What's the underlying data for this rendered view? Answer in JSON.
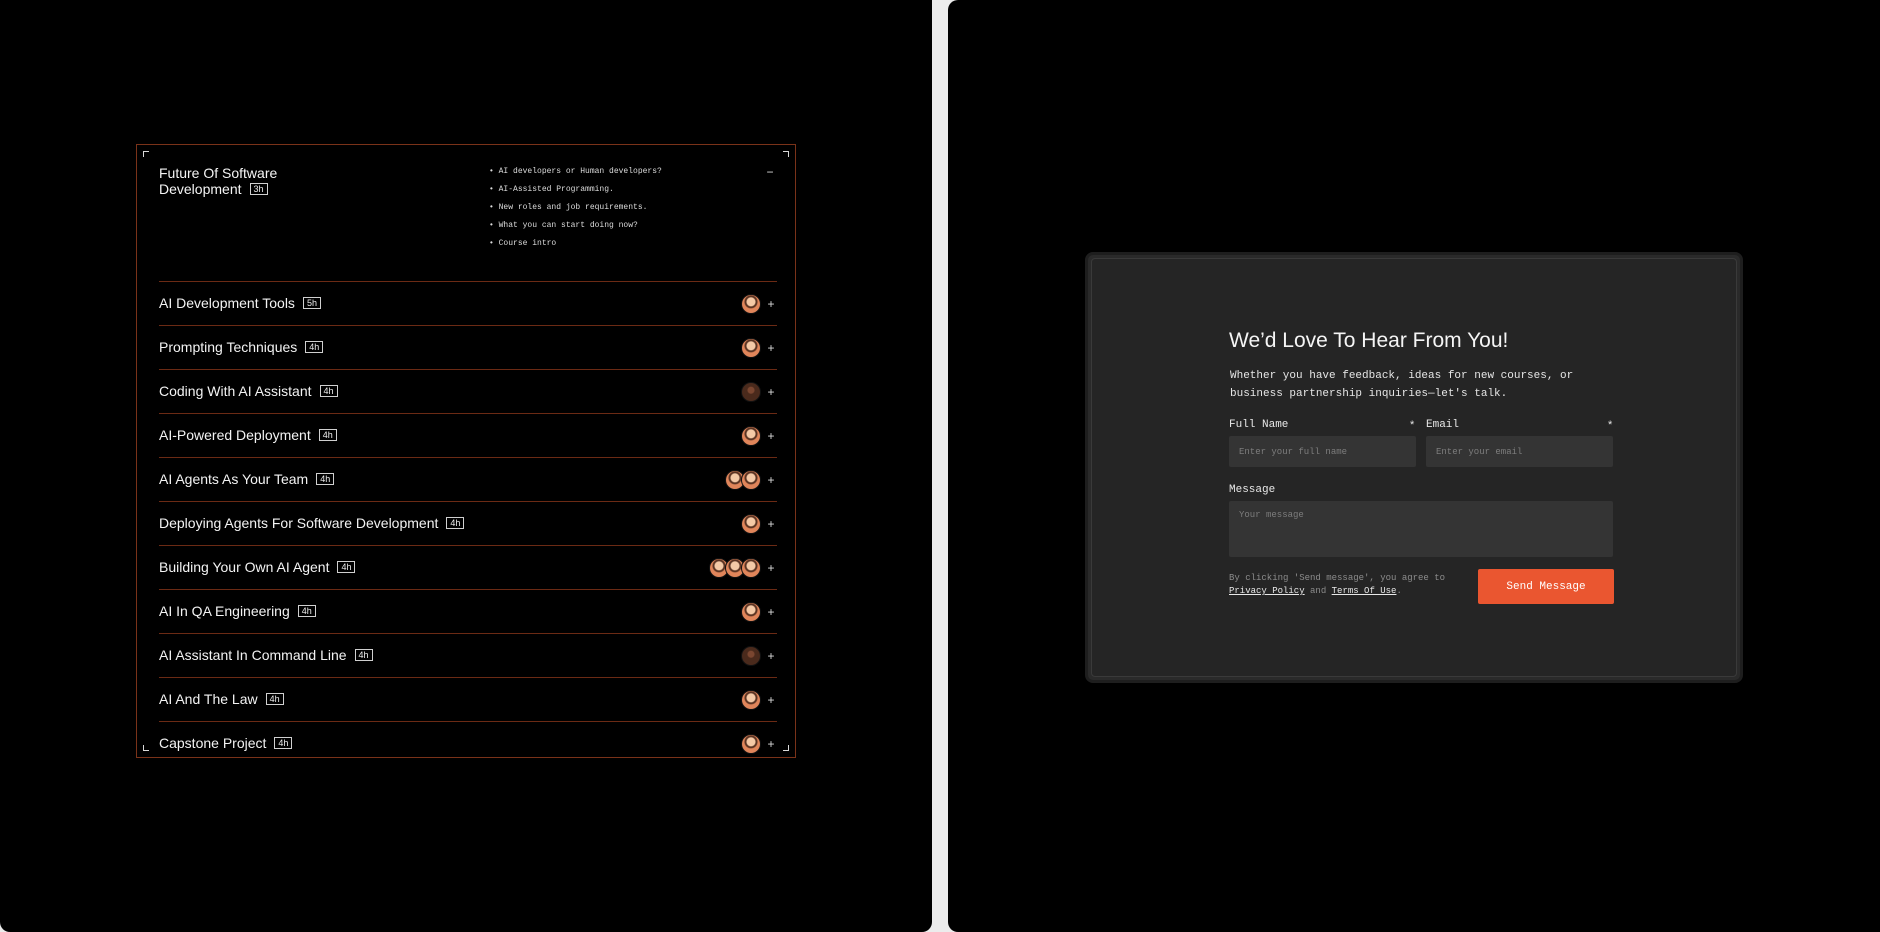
{
  "course": {
    "expanded": {
      "title": "Future Of Software Development",
      "duration": "3h",
      "topics": [
        "AI developers or Human developers?",
        "AI-Assisted Programming.",
        "New roles and job requirements.",
        "What you can start doing now?",
        "Course intro"
      ],
      "toggle": "−"
    },
    "rows": [
      {
        "title": "AI Development Tools",
        "duration": "5h",
        "avatars": 1
      },
      {
        "title": "Prompting Techniques",
        "duration": "4h",
        "avatars": 1
      },
      {
        "title": "Coding With AI Assistant",
        "duration": "4h",
        "avatars": 1
      },
      {
        "title": "AI-Powered Deployment",
        "duration": "4h",
        "avatars": 1
      },
      {
        "title": "AI Agents As Your Team",
        "duration": "4h",
        "avatars": 2
      },
      {
        "title": "Deploying Agents For Software Development",
        "duration": "4h",
        "avatars": 1
      },
      {
        "title": "Building Your Own AI Agent",
        "duration": "4h",
        "avatars": 3
      },
      {
        "title": "AI In QA Engineering",
        "duration": "4h",
        "avatars": 1
      },
      {
        "title": "AI Assistant In Command Line",
        "duration": "4h",
        "avatars": 1
      },
      {
        "title": "AI And The Law",
        "duration": "4h",
        "avatars": 1
      },
      {
        "title": "Capstone Project",
        "duration": "4h",
        "avatars": 1
      }
    ],
    "plus": "+"
  },
  "contact": {
    "title": "We’d Love To Hear From You!",
    "subtitle": "Whether you have feedback, ideas for new courses, or business partnership inquiries—let's talk.",
    "full_name_label": "Full Name",
    "full_name_placeholder": "Enter your full name",
    "email_label": "Email",
    "email_placeholder": "Enter your email",
    "required_mark": "*",
    "message_label": "Message",
    "message_placeholder": "Your message",
    "legal_prefix": "By clicking 'Send message', you agree to",
    "privacy_link": "Privacy Policy",
    "legal_and": "and",
    "terms_link": "Terms Of Use",
    "legal_suffix": ".",
    "send_label": "Send Message",
    "accent": "#ea5630"
  }
}
